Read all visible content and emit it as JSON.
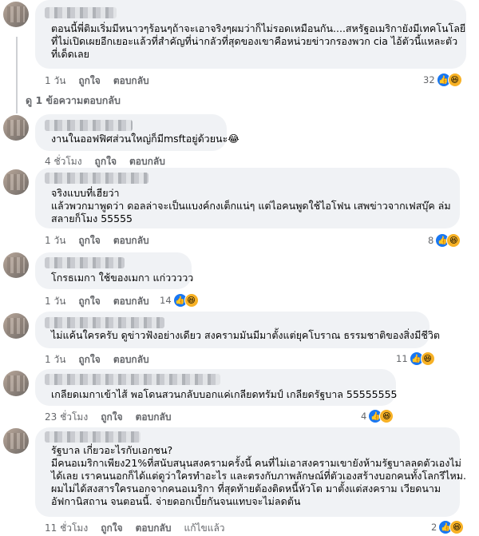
{
  "comments": [
    {
      "lines": [
        "ตอนนี้พี่ติมเริ่มมีหนาวๆร้อนๆถ้าจะเอาจริงๆผมว่าก็ไม่รอดเหมือนกัน....สหรัฐอเมริกายังมีเทคโนโลยี",
        "ที่ไม่เปิดเผยอีกเยอะแล้วที่สำคัญที่น่ากลัวที่สุดของเขาคือหน่วยข่าวกรองพวก cia ไอ้ตัวนี้แหละตัว",
        "ที่เด็ดเลย"
      ],
      "time": "1 วัน",
      "like": "ถูกใจ",
      "reply": "ตอบกลับ",
      "reactions": "32"
    },
    {
      "lines": [
        "งานในออฟฟิศส่วนใหญ่ก็มีmsftอยู่ด้วยนะ😂"
      ],
      "time": "4 ชั่วโมง",
      "like": "ถูกใจ",
      "reply": "ตอบกลับ",
      "reactions": ""
    },
    {
      "lines": [
        "จริงแบบที่เฮียว่า",
        "แล้วพวกมาพูดว่า ดอลล่าจะเป็นแบงค์กงเต็กแน่ๆ แต่ไอคนพูดใช้ไอโฟน เสพข่าวจากเฟสบุ๊ค ล่ม",
        "สลายก็โมง 55555"
      ],
      "time": "1 วัน",
      "like": "ถูกใจ",
      "reply": "ตอบกลับ",
      "reactions": "8"
    },
    {
      "lines": [
        "โกรธเมกา ใช้ของเมกา แก่ววววว"
      ],
      "time": "1 วัน",
      "like": "ถูกใจ",
      "reply": "ตอบกลับ",
      "reactions": "14"
    },
    {
      "lines": [
        "ไม่แค้นใครครับ ดูข่าวฟังอย่างเดียว สงครามมันมีมาตั้งแต่ยุคโบราณ ธรรมชาติของสิ่งมีชีวิต"
      ],
      "time": "1 วัน",
      "like": "ถูกใจ",
      "reply": "ตอบกลับ",
      "reactions": "11"
    },
    {
      "lines": [
        "เกลียดเมกาเข้าไส้ พอโดนสวนกลับบอกแค่เกลียดทรัมป์ เกลียดรัฐบาล 55555555"
      ],
      "time": "23 ชั่วโมง",
      "like": "ถูกใจ",
      "reply": "ตอบกลับ",
      "reactions": "4"
    },
    {
      "lines": [
        "รัฐบาล เกี่ยวอะไรกับเอกชน?",
        "มีคนอเมริกาเพียง21%ที่สนับสนุนสงครามครั้งนี้ คนที่ไม่เอาสงครามเขายังห้ามรัฐบาลลดตัวเองไม่",
        "ได้เลย เราคนนอกก็ได้แต่ดูว่าใครทำอะไร และตรงกับภาพลักษณ์ที่ตัวเองสร้างบอกคนทั้งโลกรึไหม.",
        "ผมไม่ได้สงสารใครนอกจากคนอเมริกา ที่สุดท้ายต้องติดหนี้หัวโต มาตั้งแต่สงคราม เวียดนาม",
        "อัฟกานิสถาน จนตอนนี้. จ่ายดอกเบี้ยกันจนแทบจะไม่ลดต้น"
      ],
      "time": "11 ชั่วโมง",
      "like": "ถูกใจ",
      "reply": "ตอบกลับ",
      "edited": "แก้ไขแล้ว",
      "reactions": "2"
    }
  ],
  "view_replies": "ดู 1 ข้อความตอบกลับ",
  "icons": {
    "like": "like-icon",
    "haha": "haha-icon",
    "more": "more-options-icon"
  },
  "colors": {
    "like": "#1877f2",
    "bubble": "#f0f2f5",
    "meta": "#65676b"
  }
}
